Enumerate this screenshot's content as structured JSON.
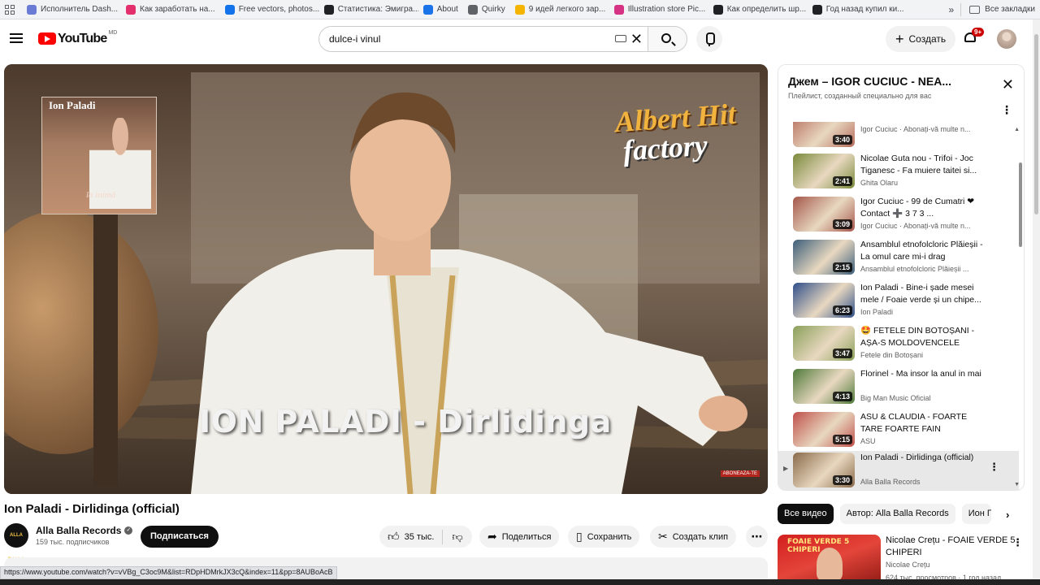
{
  "bookmarks": {
    "items": [
      {
        "label": "Исполнитель Dash...",
        "color": "#6a7bd6"
      },
      {
        "label": "Как заработать на...",
        "color": "#e3306c"
      },
      {
        "label": "Free vectors, photos...",
        "color": "#1273eb"
      },
      {
        "label": "Статистика: Эмигра...",
        "color": "#202124"
      },
      {
        "label": "About",
        "color": "#1a73e8"
      },
      {
        "label": "Quirky",
        "color": "#5f6368"
      },
      {
        "label": "9 идей легкого зар...",
        "color": "#f4b400"
      },
      {
        "label": "Illustration store Pic...",
        "color": "#d63384"
      },
      {
        "label": "Как определить шр...",
        "color": "#202124"
      },
      {
        "label": "Год назад купил ки...",
        "color": "#202124"
      }
    ],
    "more": "»",
    "all_bookmarks": "Все закладки"
  },
  "header": {
    "logo": "YouTube",
    "region": "MD",
    "search_value": "dulce-i vinul",
    "create_label": "Создать",
    "notif_badge": "9+"
  },
  "player": {
    "album_title": "Ion Paladi",
    "album_script": "la inimă",
    "brand_line1": "Albert Hit",
    "brand_line2": "factory",
    "overlay_title": "ION PALADI - Dirlidinga",
    "watermark": "ABONEAZA-TE"
  },
  "video": {
    "title": "Ion Paladi - Dirlidinga (official)",
    "channel": "Alla Balla Records",
    "channel_avatar_text": "ALLA BALLA",
    "subscribers": "159 тыс. подписчиков",
    "subscribe_label": "Подписаться",
    "likes": "35 тыс.",
    "share_label": "Поделиться",
    "save_label": "Сохранить",
    "clip_label": "Создать клип",
    "status_url": "https://www.youtube.com/watch?v=vVBg_C3oc9M&list=RDpHDMrkJX3cQ&index=11&pp=8AUBoAcB"
  },
  "playlist": {
    "title": "Джем – IGOR CUCIUC - NEA...",
    "subtitle": "Плейлист, созданный специально для вас",
    "items": [
      {
        "title": "🙏🙌",
        "channel": "Igor Cuciuc · Abonați-vă multe n...",
        "duration": "3:40",
        "thumb": "#b56b5a"
      },
      {
        "title": "Nicolae Guta nou - Trifoi - Joc Tiganesc - Fa muiere taitei si...",
        "channel": "Ghita Olaru",
        "duration": "2:41",
        "thumb": "#7a8a3a"
      },
      {
        "title": "Igor Cuciuc - 99 de Cumatri ❤ Contact ➕ 3 7 3 ...",
        "channel": "Igor Cuciuc · Abonați-vă multe n...",
        "duration": "3:09",
        "thumb": "#a5564a"
      },
      {
        "title": "Ansamblul etnofolcloric Plăieșii - La omul care mi-i drag",
        "channel": "Ansamblul etnofolcloric Plăieșii ...",
        "duration": "2:15",
        "thumb": "#3b5e7a"
      },
      {
        "title": "Ion Paladi - Bine-i șade mesei mele / Foaie verde și un chipe...",
        "channel": "Ion Paladi",
        "duration": "6:23",
        "thumb": "#2f4f8a"
      },
      {
        "title": "🤩 FETELE DIN BOTOȘANI - AȘA-S MOLDOVENCELE",
        "channel": "Fetele din Botoșani",
        "duration": "3:47",
        "thumb": "#8aa05a"
      },
      {
        "title": "Florinel - Ma insor la anul in mai",
        "channel": "Big Man Music Oficial",
        "duration": "4:13",
        "thumb": "#4f7a3a"
      },
      {
        "title": "ASU & CLAUDIA - FOARTE TARE FOARTE FAIN",
        "channel": "ASU",
        "duration": "5:15",
        "thumb": "#c0504a"
      },
      {
        "title": "Ion Paladi - Dirlidinga (official)",
        "channel": "Alla Balla Records",
        "duration": "3:30",
        "thumb": "#8a6a4a",
        "active": true
      }
    ]
  },
  "chips": [
    "Все видео",
    "Автор: Alla Balla Records",
    "Ион Па"
  ],
  "recommendation": {
    "thumb_text": "FOAIE VERDE 5 CHIPERI",
    "title": "Nicolae Crețu - FOAIE VERDE 5 CHIPERI",
    "channel": "Nicolae Crețu",
    "meta": "624 тыс. просмотров · 1 год назад"
  }
}
